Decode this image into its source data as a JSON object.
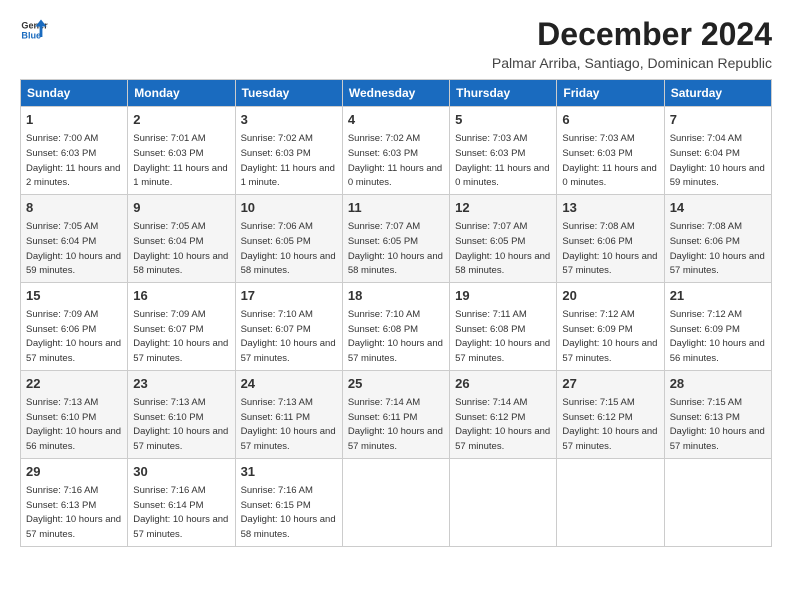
{
  "logo": {
    "general": "General",
    "blue": "Blue"
  },
  "title": "December 2024",
  "subtitle": "Palmar Arriba, Santiago, Dominican Republic",
  "days_of_week": [
    "Sunday",
    "Monday",
    "Tuesday",
    "Wednesday",
    "Thursday",
    "Friday",
    "Saturday"
  ],
  "weeks": [
    [
      {
        "day": "1",
        "sunrise": "7:00 AM",
        "sunset": "6:03 PM",
        "daylight": "11 hours and 2 minutes."
      },
      {
        "day": "2",
        "sunrise": "7:01 AM",
        "sunset": "6:03 PM",
        "daylight": "11 hours and 1 minute."
      },
      {
        "day": "3",
        "sunrise": "7:02 AM",
        "sunset": "6:03 PM",
        "daylight": "11 hours and 1 minute."
      },
      {
        "day": "4",
        "sunrise": "7:02 AM",
        "sunset": "6:03 PM",
        "daylight": "11 hours and 0 minutes."
      },
      {
        "day": "5",
        "sunrise": "7:03 AM",
        "sunset": "6:03 PM",
        "daylight": "11 hours and 0 minutes."
      },
      {
        "day": "6",
        "sunrise": "7:03 AM",
        "sunset": "6:03 PM",
        "daylight": "11 hours and 0 minutes."
      },
      {
        "day": "7",
        "sunrise": "7:04 AM",
        "sunset": "6:04 PM",
        "daylight": "10 hours and 59 minutes."
      }
    ],
    [
      {
        "day": "8",
        "sunrise": "7:05 AM",
        "sunset": "6:04 PM",
        "daylight": "10 hours and 59 minutes."
      },
      {
        "day": "9",
        "sunrise": "7:05 AM",
        "sunset": "6:04 PM",
        "daylight": "10 hours and 58 minutes."
      },
      {
        "day": "10",
        "sunrise": "7:06 AM",
        "sunset": "6:05 PM",
        "daylight": "10 hours and 58 minutes."
      },
      {
        "day": "11",
        "sunrise": "7:07 AM",
        "sunset": "6:05 PM",
        "daylight": "10 hours and 58 minutes."
      },
      {
        "day": "12",
        "sunrise": "7:07 AM",
        "sunset": "6:05 PM",
        "daylight": "10 hours and 58 minutes."
      },
      {
        "day": "13",
        "sunrise": "7:08 AM",
        "sunset": "6:06 PM",
        "daylight": "10 hours and 57 minutes."
      },
      {
        "day": "14",
        "sunrise": "7:08 AM",
        "sunset": "6:06 PM",
        "daylight": "10 hours and 57 minutes."
      }
    ],
    [
      {
        "day": "15",
        "sunrise": "7:09 AM",
        "sunset": "6:06 PM",
        "daylight": "10 hours and 57 minutes."
      },
      {
        "day": "16",
        "sunrise": "7:09 AM",
        "sunset": "6:07 PM",
        "daylight": "10 hours and 57 minutes."
      },
      {
        "day": "17",
        "sunrise": "7:10 AM",
        "sunset": "6:07 PM",
        "daylight": "10 hours and 57 minutes."
      },
      {
        "day": "18",
        "sunrise": "7:10 AM",
        "sunset": "6:08 PM",
        "daylight": "10 hours and 57 minutes."
      },
      {
        "day": "19",
        "sunrise": "7:11 AM",
        "sunset": "6:08 PM",
        "daylight": "10 hours and 57 minutes."
      },
      {
        "day": "20",
        "sunrise": "7:12 AM",
        "sunset": "6:09 PM",
        "daylight": "10 hours and 57 minutes."
      },
      {
        "day": "21",
        "sunrise": "7:12 AM",
        "sunset": "6:09 PM",
        "daylight": "10 hours and 56 minutes."
      }
    ],
    [
      {
        "day": "22",
        "sunrise": "7:13 AM",
        "sunset": "6:10 PM",
        "daylight": "10 hours and 56 minutes."
      },
      {
        "day": "23",
        "sunrise": "7:13 AM",
        "sunset": "6:10 PM",
        "daylight": "10 hours and 57 minutes."
      },
      {
        "day": "24",
        "sunrise": "7:13 AM",
        "sunset": "6:11 PM",
        "daylight": "10 hours and 57 minutes."
      },
      {
        "day": "25",
        "sunrise": "7:14 AM",
        "sunset": "6:11 PM",
        "daylight": "10 hours and 57 minutes."
      },
      {
        "day": "26",
        "sunrise": "7:14 AM",
        "sunset": "6:12 PM",
        "daylight": "10 hours and 57 minutes."
      },
      {
        "day": "27",
        "sunrise": "7:15 AM",
        "sunset": "6:12 PM",
        "daylight": "10 hours and 57 minutes."
      },
      {
        "day": "28",
        "sunrise": "7:15 AM",
        "sunset": "6:13 PM",
        "daylight": "10 hours and 57 minutes."
      }
    ],
    [
      {
        "day": "29",
        "sunrise": "7:16 AM",
        "sunset": "6:13 PM",
        "daylight": "10 hours and 57 minutes."
      },
      {
        "day": "30",
        "sunrise": "7:16 AM",
        "sunset": "6:14 PM",
        "daylight": "10 hours and 57 minutes."
      },
      {
        "day": "31",
        "sunrise": "7:16 AM",
        "sunset": "6:15 PM",
        "daylight": "10 hours and 58 minutes."
      },
      null,
      null,
      null,
      null
    ]
  ]
}
